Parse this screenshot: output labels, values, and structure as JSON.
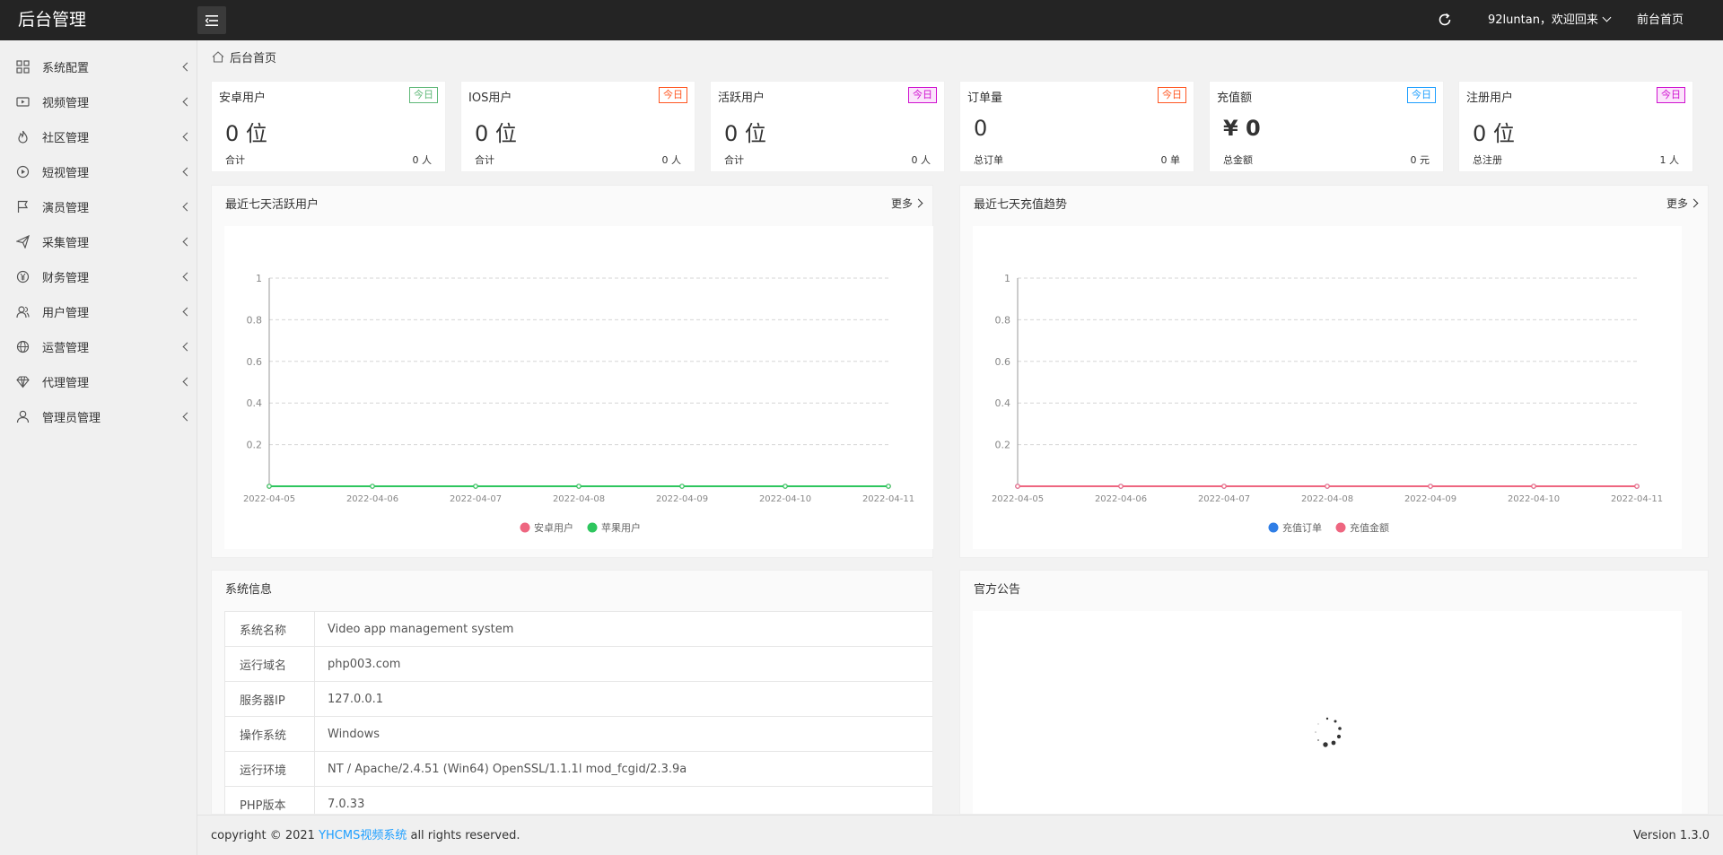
{
  "header": {
    "brand": "后台管理",
    "user": "92luntan，欢迎回来",
    "front_link": "前台首页"
  },
  "sidebar": {
    "items": [
      {
        "label": "系统配置",
        "icon": "apps-icon"
      },
      {
        "label": "视频管理",
        "icon": "video-icon"
      },
      {
        "label": "社区管理",
        "icon": "fire-icon"
      },
      {
        "label": "短视管理",
        "icon": "play-circle-icon"
      },
      {
        "label": "演员管理",
        "icon": "flag-icon"
      },
      {
        "label": "采集管理",
        "icon": "send-icon"
      },
      {
        "label": "财务管理",
        "icon": "yen-icon"
      },
      {
        "label": "用户管理",
        "icon": "users-icon"
      },
      {
        "label": "运营管理",
        "icon": "globe-icon"
      },
      {
        "label": "代理管理",
        "icon": "diamond-icon"
      },
      {
        "label": "管理员管理",
        "icon": "user-icon"
      }
    ]
  },
  "breadcrumb": "后台首页",
  "stats": [
    {
      "title": "安卓用户",
      "badge": "今日",
      "badge_color": "#5fb878",
      "value": "0 位",
      "foot_l": "合计",
      "foot_r": "0 人"
    },
    {
      "title": "IOS用户",
      "badge": "今日",
      "badge_color": "#ff5722",
      "value": "0 位",
      "foot_l": "合计",
      "foot_r": "0 人"
    },
    {
      "title": "活跃用户",
      "badge": "今日",
      "badge_color": "#d012d0",
      "value": "0 位",
      "foot_l": "合计",
      "foot_r": "0 人"
    },
    {
      "title": "订单量",
      "badge": "今日",
      "badge_color": "#ff5722",
      "value": "0",
      "foot_l": "总订单",
      "foot_r": "0 单"
    },
    {
      "title": "充值额",
      "badge": "今日",
      "badge_color": "#1e9fff",
      "value": "¥ 0",
      "foot_l": "总金额",
      "foot_r": "0 元"
    },
    {
      "title": "注册用户",
      "badge": "今日",
      "badge_color": "#d012d0",
      "value": "0 位",
      "foot_l": "总注册",
      "foot_r": "1 人"
    }
  ],
  "panels": {
    "active_title": "最近七天活跃用户",
    "recharge_title": "最近七天充值趋势",
    "more": "更多",
    "sysinfo_title": "系统信息",
    "notice_title": "官方公告"
  },
  "chart_data": [
    {
      "type": "line",
      "title": "最近七天活跃用户",
      "categories": [
        "2022-04-05",
        "2022-04-06",
        "2022-04-07",
        "2022-04-08",
        "2022-04-09",
        "2022-04-10",
        "2022-04-11"
      ],
      "yticks": [
        "1",
        "0.8",
        "0.6",
        "0.4",
        "0.2"
      ],
      "ylim": [
        0,
        1
      ],
      "grid": true,
      "legend": "bottom",
      "series": [
        {
          "name": "安卓用户",
          "color": "#ee6680",
          "values": [
            0,
            0,
            0,
            0,
            0,
            0,
            0
          ]
        },
        {
          "name": "苹果用户",
          "color": "#2ec65e",
          "values": [
            0,
            0,
            0,
            0,
            0,
            0,
            0
          ]
        }
      ]
    },
    {
      "type": "line",
      "title": "最近七天充值趋势",
      "categories": [
        "2022-04-05",
        "2022-04-06",
        "2022-04-07",
        "2022-04-08",
        "2022-04-09",
        "2022-04-10",
        "2022-04-11"
      ],
      "yticks": [
        "1",
        "0.8",
        "0.6",
        "0.4",
        "0.2"
      ],
      "ylim": [
        0,
        1
      ],
      "grid": true,
      "legend": "bottom",
      "series": [
        {
          "name": "充值订单",
          "color": "#2f7ee6",
          "values": [
            0,
            0,
            0,
            0,
            0,
            0,
            0
          ]
        },
        {
          "name": "充值金额",
          "color": "#ee6680",
          "values": [
            0,
            0,
            0,
            0,
            0,
            0,
            0
          ]
        }
      ]
    }
  ],
  "sysinfo": [
    {
      "k": "系统名称",
      "v": "Video app management system"
    },
    {
      "k": "运行域名",
      "v": "php003.com"
    },
    {
      "k": "服务器IP",
      "v": "127.0.0.1"
    },
    {
      "k": "操作系统",
      "v": "Windows"
    },
    {
      "k": "运行环境",
      "v": "NT / Apache/2.4.51 (Win64) OpenSSL/1.1.1l mod_fcgid/2.3.9a"
    },
    {
      "k": "PHP版本",
      "v": "7.0.33"
    }
  ],
  "footer": {
    "copy_pre": "copyright © 2021 ",
    "copy_link": "YHCMS视频系统",
    "copy_post": " all rights reserved.",
    "version": "Version 1.3.0"
  }
}
